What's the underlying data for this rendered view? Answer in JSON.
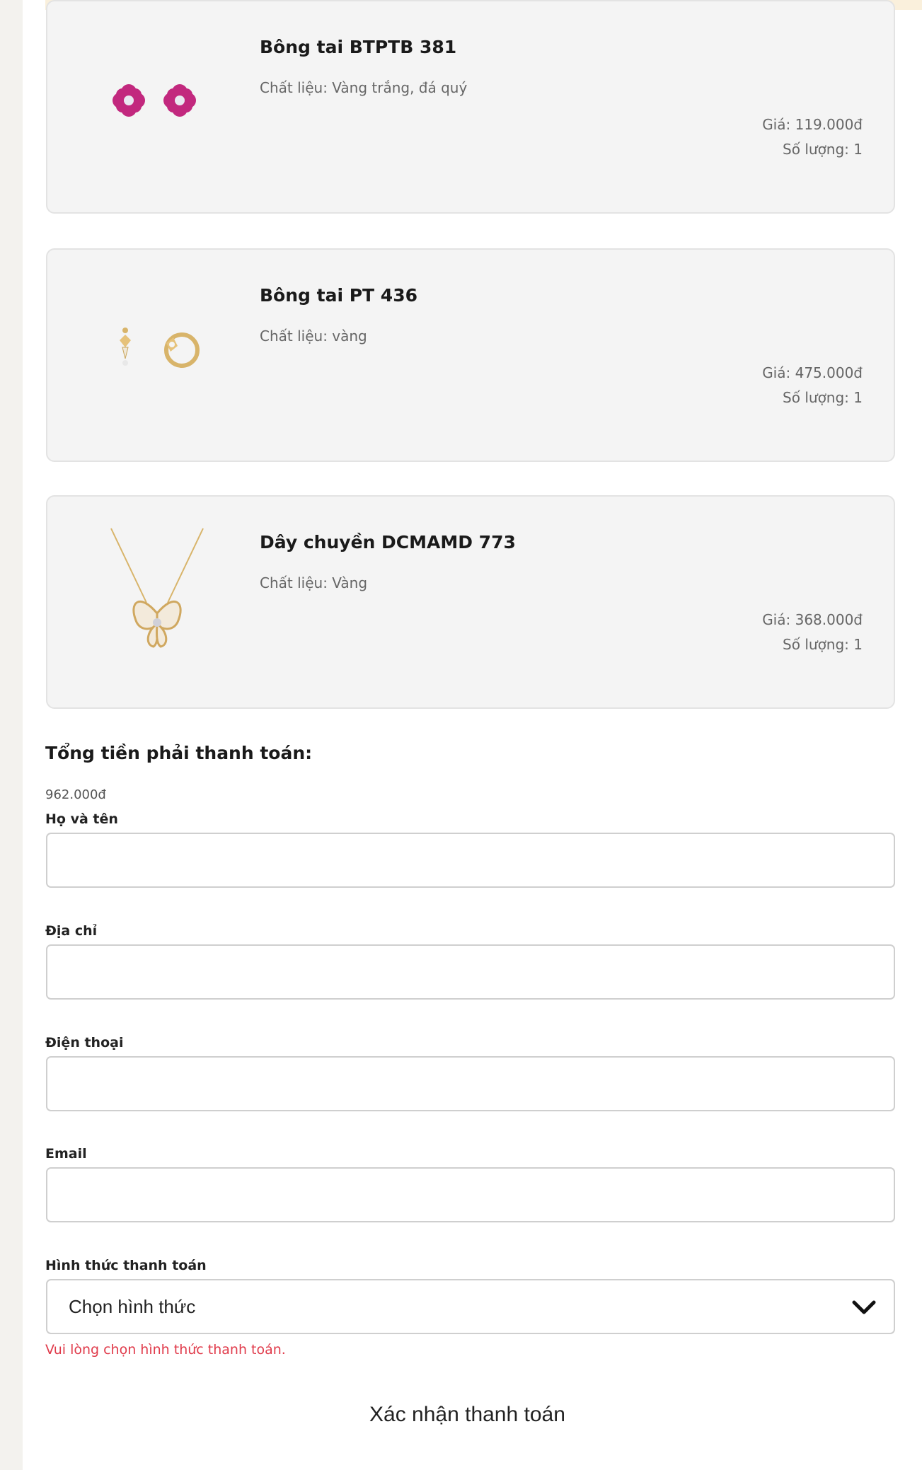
{
  "products": [
    {
      "name": "Bông tai BTPTB 381",
      "material": "Chất liệu: Vàng trắng, đá quý",
      "price": "Giá: 119.000đ",
      "quantity": "Số lượng: 1",
      "image_icon": "pink-flower-earrings-icon"
    },
    {
      "name": "Bông tai PT 436",
      "material": "Chất liệu: vàng",
      "price": "Giá: 475.000đ",
      "quantity": "Số lượng: 1",
      "image_icon": "gold-hoop-earrings-icon"
    },
    {
      "name": "Dây chuyền DCMAMD 773",
      "material": "Chất liệu: Vàng",
      "price": "Giá: 368.000đ",
      "quantity": "Số lượng: 1",
      "image_icon": "butterfly-necklace-icon"
    }
  ],
  "total": {
    "label": "Tổng tiền phải thanh toán:",
    "value": "962.000đ"
  },
  "form": {
    "name_label": "Họ và tên",
    "name_value": "",
    "address_label": "Địa chỉ",
    "address_value": "",
    "phone_label": "Điện thoại",
    "phone_value": "",
    "email_label": "Email",
    "email_value": "",
    "payment_label": "Hình thức thanh toán",
    "payment_selected": "Chọn hình thức",
    "payment_error": "Vui lòng chọn hình thức thanh toán.",
    "submit_label": "Xác nhận thanh toán"
  },
  "colors": {
    "page_background": "#f3f2ee",
    "card_background": "#f4f4f4",
    "error": "#e03b4b",
    "earring_pink": "#c2287e",
    "gold": "#d8b46a"
  }
}
